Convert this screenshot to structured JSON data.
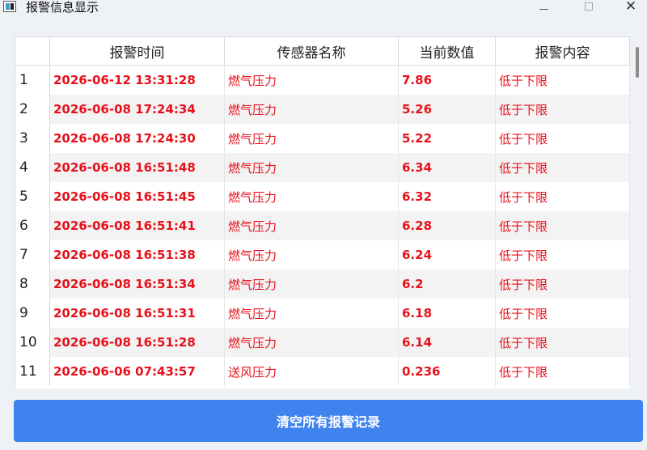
{
  "window": {
    "title": "报警信息显示",
    "minimize_icon": "minimize-icon",
    "maximize_icon": "maximize-icon",
    "close_icon": "close-icon"
  },
  "table": {
    "headers": [
      "",
      "报警时间",
      "传感器名称",
      "当前数值",
      "报警内容"
    ],
    "rows": [
      {
        "index": "1",
        "time": "2026-06-12 13:31:28",
        "sensor": "燃气压力",
        "value": "7.86",
        "content": "低于下限"
      },
      {
        "index": "2",
        "time": "2026-06-08 17:24:34",
        "sensor": "燃气压力",
        "value": "5.26",
        "content": "低于下限"
      },
      {
        "index": "3",
        "time": "2026-06-08 17:24:30",
        "sensor": "燃气压力",
        "value": "5.22",
        "content": "低于下限"
      },
      {
        "index": "4",
        "time": "2026-06-08 16:51:48",
        "sensor": "燃气压力",
        "value": "6.34",
        "content": "低于下限"
      },
      {
        "index": "5",
        "time": "2026-06-08 16:51:45",
        "sensor": "燃气压力",
        "value": "6.32",
        "content": "低于下限"
      },
      {
        "index": "6",
        "time": "2026-06-08 16:51:41",
        "sensor": "燃气压力",
        "value": "6.28",
        "content": "低于下限"
      },
      {
        "index": "7",
        "time": "2026-06-08 16:51:38",
        "sensor": "燃气压力",
        "value": "6.24",
        "content": "低于下限"
      },
      {
        "index": "8",
        "time": "2026-06-08 16:51:34",
        "sensor": "燃气压力",
        "value": "6.2",
        "content": "低于下限"
      },
      {
        "index": "9",
        "time": "2026-06-08 16:51:31",
        "sensor": "燃气压力",
        "value": "6.18",
        "content": "低于下限"
      },
      {
        "index": "10",
        "time": "2026-06-08 16:51:28",
        "sensor": "燃气压力",
        "value": "6.14",
        "content": "低于下限"
      },
      {
        "index": "11",
        "time": "2026-06-06 07:43:57",
        "sensor": "送风压力",
        "value": "0.236",
        "content": "低于下限"
      }
    ]
  },
  "actions": {
    "clear_label": "清空所有报警记录"
  },
  "colors": {
    "alarm_text": "#e8101a",
    "button_bg": "#3f83ef"
  }
}
